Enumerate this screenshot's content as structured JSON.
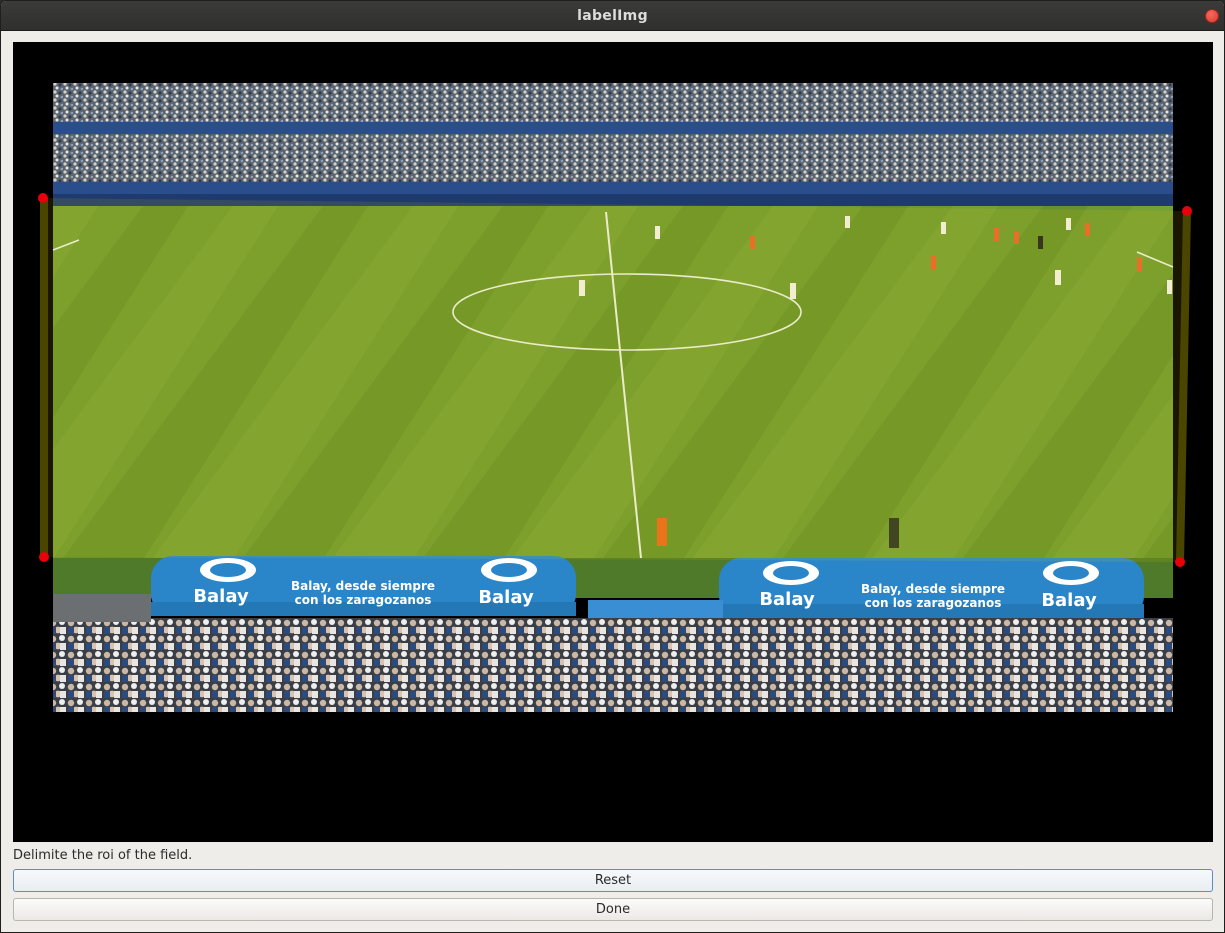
{
  "window": {
    "title": "labelImg"
  },
  "canvas": {
    "ads": {
      "brand": "Balay",
      "slogan_line1": "Balay, desde siempre",
      "slogan_line2": "con los zaragozanos"
    },
    "roi_points": 4,
    "colors": {
      "roi_point": "#e8000b",
      "pitch_light": "#7aa53a",
      "pitch_dark": "#5f8a28",
      "dugout": "#2a86c8"
    }
  },
  "status": {
    "text": "Delimite the roi of the field."
  },
  "buttons": {
    "reset": "Reset",
    "done": "Done"
  }
}
